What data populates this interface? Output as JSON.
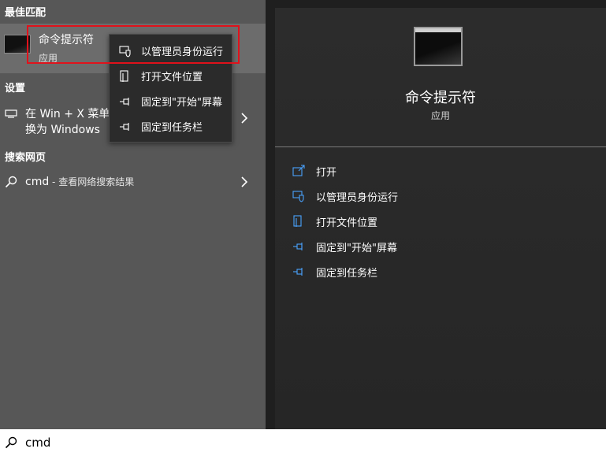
{
  "left": {
    "best_match_title": "最佳匹配",
    "best_match": {
      "title": "命令提示符",
      "subtitle": "应用"
    },
    "settings_title": "设置",
    "settings_item": {
      "line1": "在 Win + X 菜单",
      "line2": "换为 Windows"
    },
    "web_title": "搜索网页",
    "web_item": {
      "query": "cmd",
      "suffix": " - 查看网络搜索结果"
    }
  },
  "context_menu": {
    "items": [
      {
        "label": "以管理员身份运行",
        "icon": "shield-window-icon"
      },
      {
        "label": "打开文件位置",
        "icon": "file-location-icon"
      },
      {
        "label": "固定到\"开始\"屏幕",
        "icon": "pin-icon"
      },
      {
        "label": "固定到任务栏",
        "icon": "pin-icon"
      }
    ]
  },
  "right": {
    "title": "命令提示符",
    "subtitle": "应用",
    "actions": [
      {
        "label": "打开",
        "icon": "open-icon"
      },
      {
        "label": "以管理员身份运行",
        "icon": "shield-window-icon"
      },
      {
        "label": "打开文件位置",
        "icon": "file-location-icon"
      },
      {
        "label": "固定到\"开始\"屏幕",
        "icon": "pin-icon"
      },
      {
        "label": "固定到任务栏",
        "icon": "pin-icon"
      }
    ]
  },
  "search": {
    "value": "cmd"
  },
  "colors": {
    "highlight": "#e0121b",
    "icon_accent": "#4aa3ff"
  }
}
